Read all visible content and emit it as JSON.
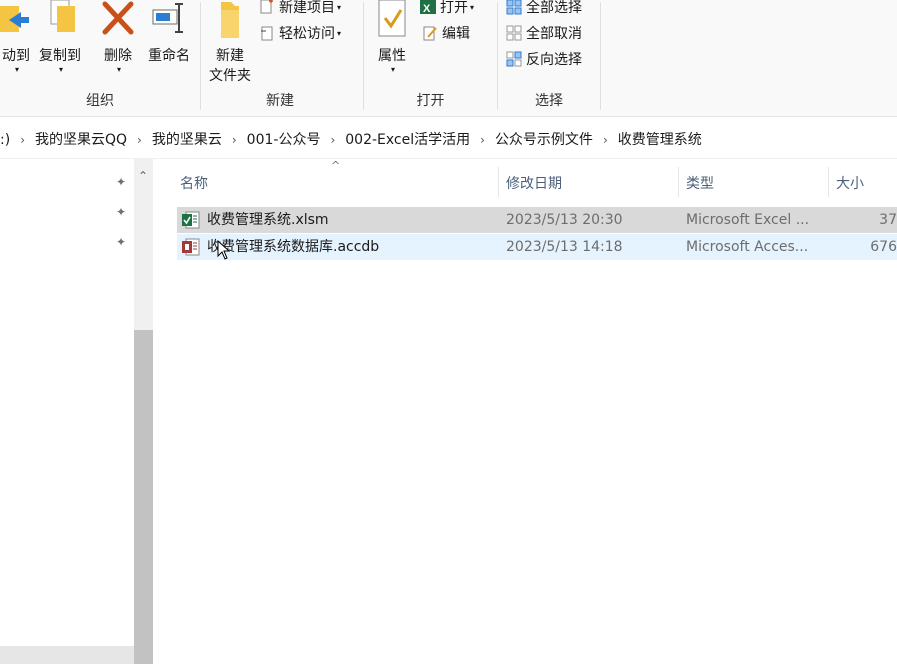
{
  "ribbon": {
    "organize": {
      "move_to": "动到",
      "copy_to": "复制到",
      "delete": "删除",
      "rename": "重命名",
      "label": "组织"
    },
    "new": {
      "new_item": "新建项目",
      "easy_access": "轻松访问",
      "new_folder_line1": "新建",
      "new_folder_line2": "文件夹",
      "label": "新建"
    },
    "open": {
      "properties": "属性",
      "open": "打开",
      "edit": "编辑",
      "label": "打开"
    },
    "select": {
      "select_all": "全部选择",
      "select_none": "全部取消",
      "invert": "反向选择",
      "label": "选择"
    }
  },
  "address": {
    "crumbs": [
      ":)",
      "我的坚果云QQ",
      "我的坚果云",
      "001-公众号",
      "002-Excel活学活用",
      "公众号示例文件",
      "收费管理系统"
    ]
  },
  "columns": {
    "name": "名称",
    "date": "修改日期",
    "type": "类型",
    "size": "大小"
  },
  "files": [
    {
      "name": "收费管理系统.xlsm",
      "date": "2023/5/13 20:30",
      "type": "Microsoft Excel ...",
      "size": "37",
      "icon": "excel-macro-icon"
    },
    {
      "name": "收费管理系统数据库.accdb",
      "date": "2023/5/13 14:18",
      "type": "Microsoft Acces...",
      "size": "676",
      "icon": "access-db-icon"
    }
  ],
  "colors": {
    "selected_row": "#d9d9d9",
    "hover_row": "#e5f3ff",
    "excel_green": "#1e7145",
    "access_red": "#a4373a"
  }
}
